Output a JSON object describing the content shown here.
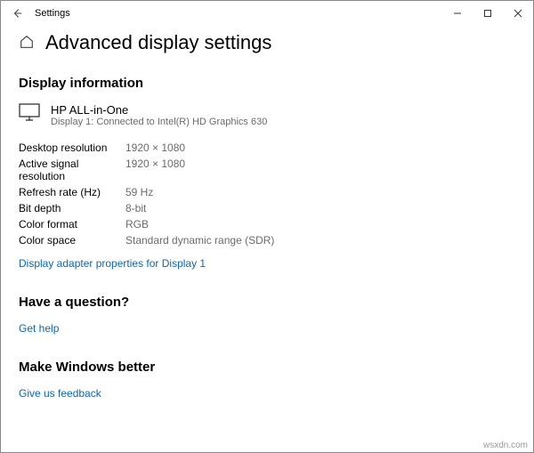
{
  "window": {
    "title": "Settings"
  },
  "page": {
    "title": "Advanced display settings"
  },
  "section_display": {
    "heading": "Display information",
    "display_name": "HP ALL-in-One",
    "display_sub": "Display 1: Connected to Intel(R) HD Graphics 630",
    "rows": {
      "desktop_res_k": "Desktop resolution",
      "desktop_res_v": "1920 × 1080",
      "active_res_k": "Active signal resolution",
      "active_res_v": "1920 × 1080",
      "refresh_k": "Refresh rate (Hz)",
      "refresh_v": "59 Hz",
      "bitdepth_k": "Bit depth",
      "bitdepth_v": "8-bit",
      "colorfmt_k": "Color format",
      "colorfmt_v": "RGB",
      "colorspace_k": "Color space",
      "colorspace_v": "Standard dynamic range (SDR)"
    },
    "adapter_link": "Display adapter properties for Display 1"
  },
  "section_question": {
    "heading": "Have a question?",
    "link": "Get help"
  },
  "section_feedback": {
    "heading": "Make Windows better",
    "link": "Give us feedback"
  },
  "watermark": "wsxdn.com"
}
